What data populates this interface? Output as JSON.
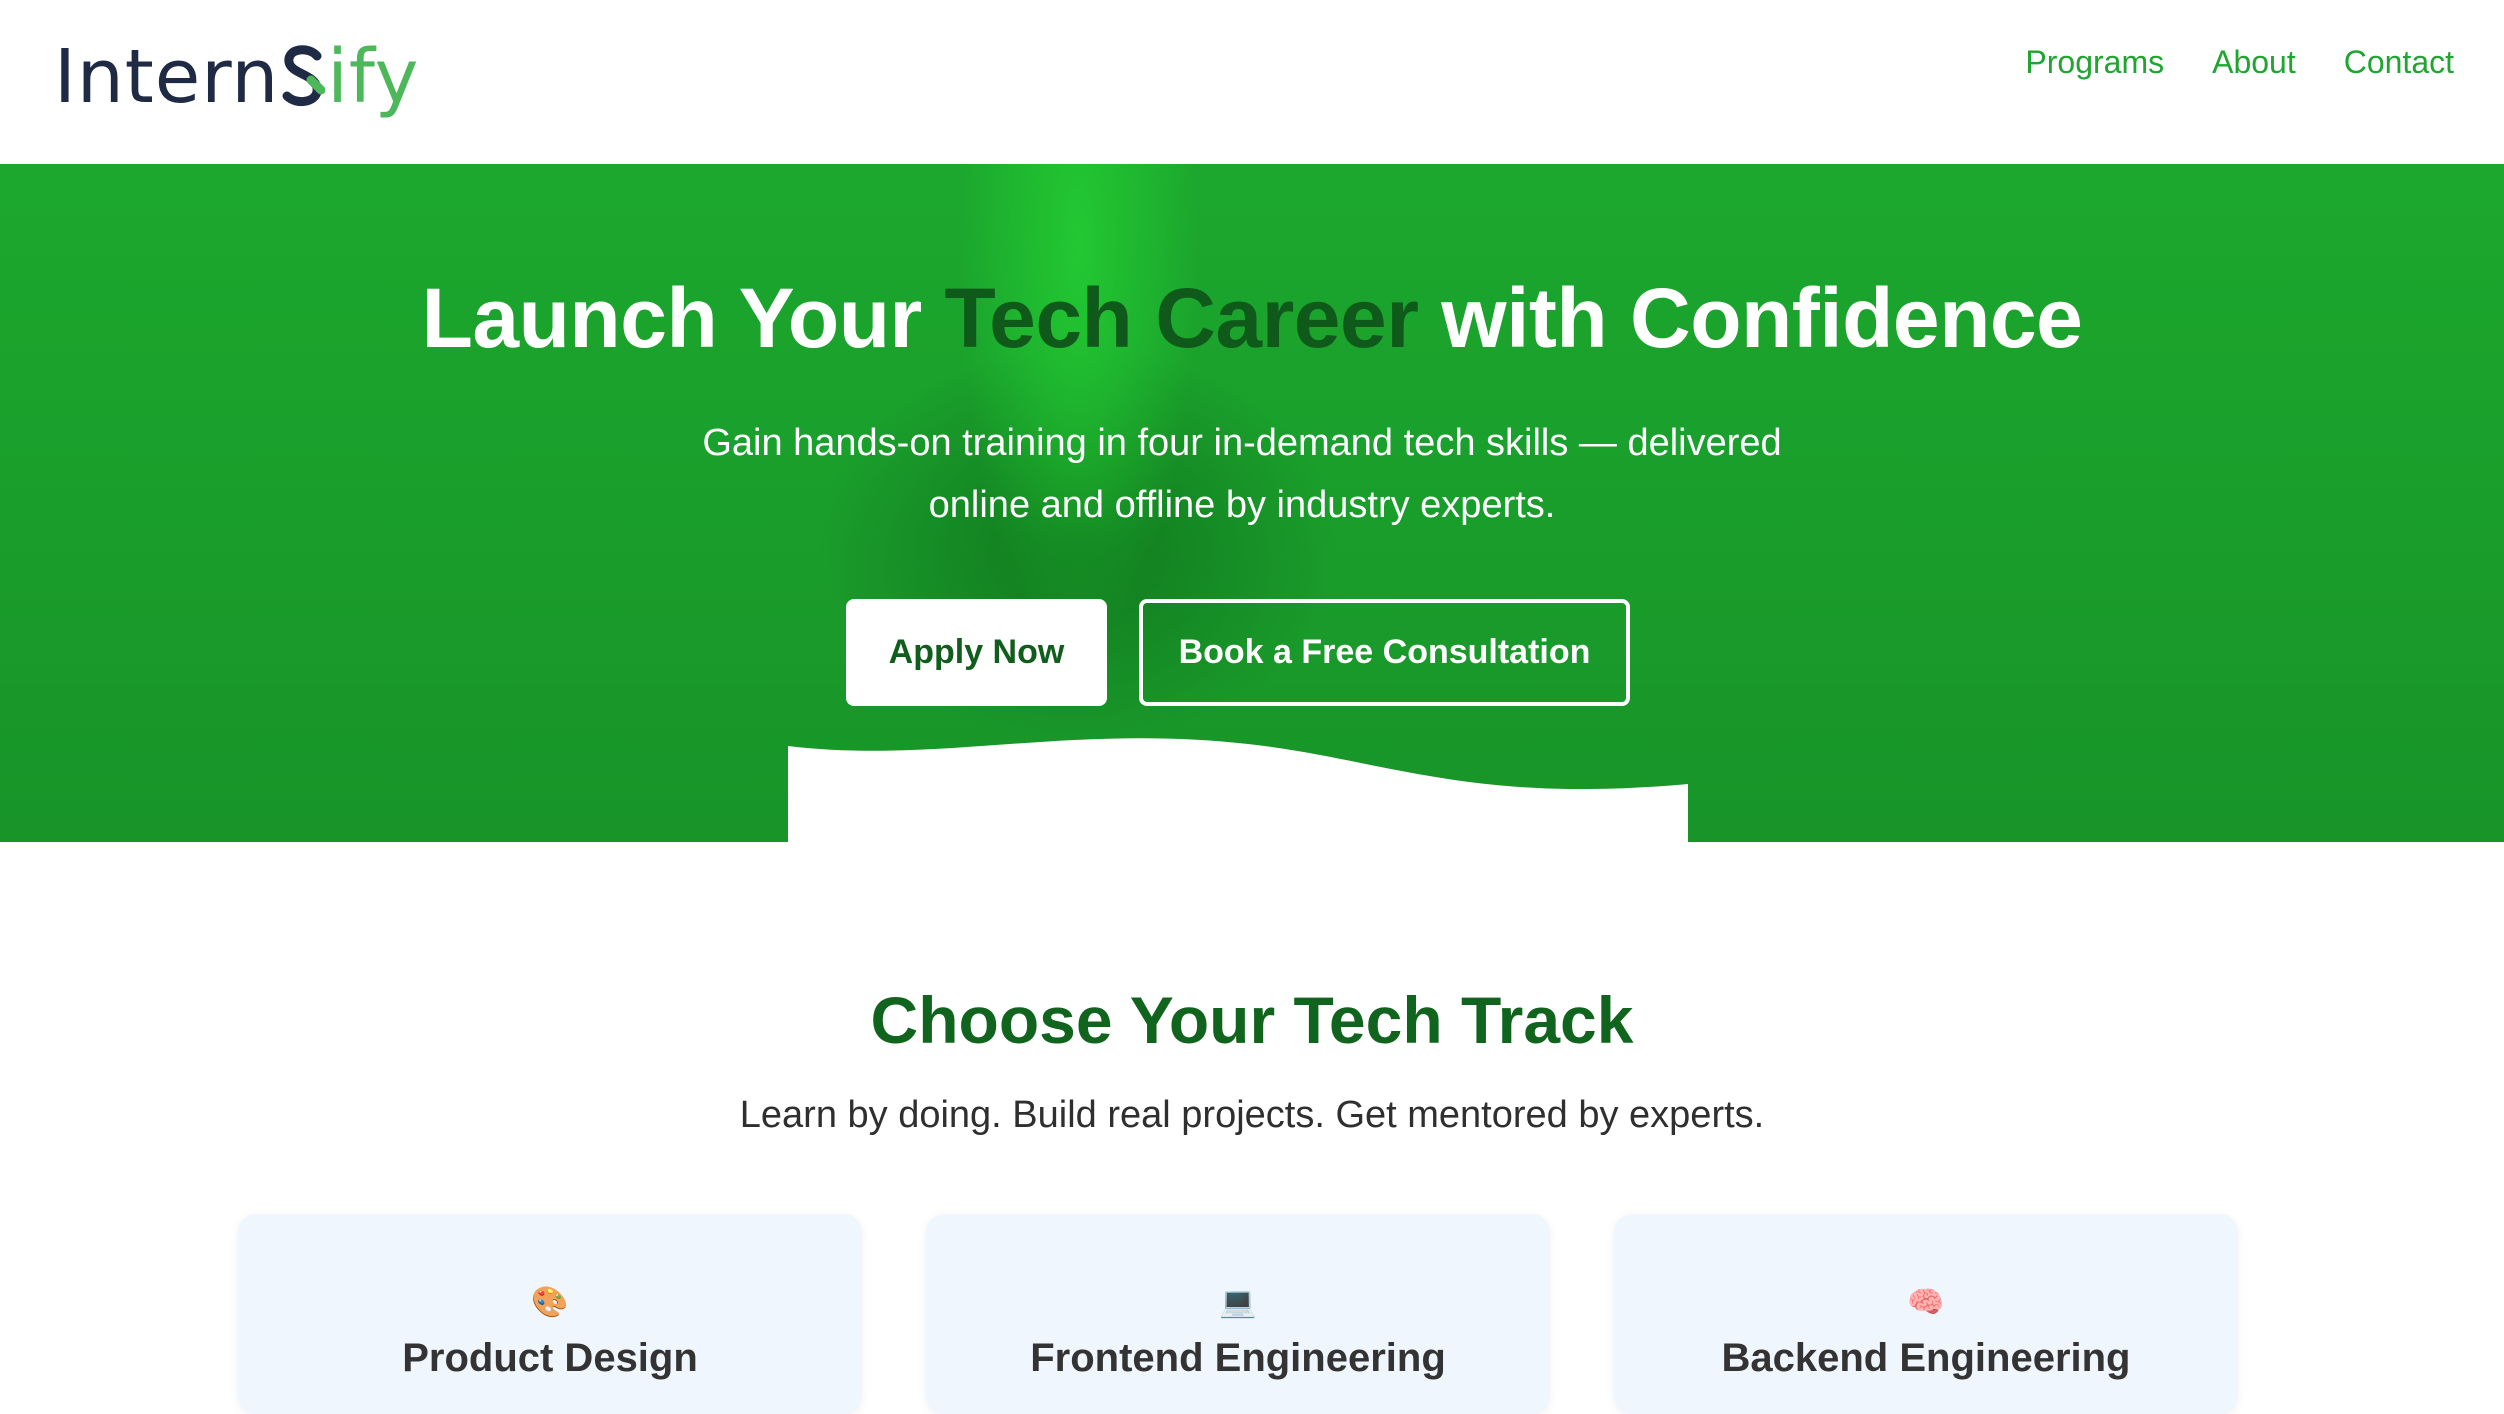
{
  "brand": {
    "logo_dark": "Intern",
    "logo_green": "ify",
    "colors": {
      "primary": "#1ca82e",
      "dark_green": "#0f5a1a",
      "logo_dark": "#1f2a44",
      "logo_green": "#4cb85a"
    }
  },
  "nav": {
    "items": [
      {
        "label": "Programs"
      },
      {
        "label": "About"
      },
      {
        "label": "Contact"
      }
    ]
  },
  "hero": {
    "title_before": "Launch Your ",
    "title_accent": "Tech Career",
    "title_after": " with Confidence",
    "subtitle": "Gain hands-on training in four in-demand tech skills — delivered online and offline by industry experts.",
    "apply_label": "Apply Now",
    "book_label": "Book a Free Consultation"
  },
  "tracks": {
    "title": "Choose Your Tech Track",
    "subtitle": "Learn by doing. Build real projects. Get mentored by experts.",
    "cards": [
      {
        "icon": "palette-icon",
        "icon_glyph": "🎨",
        "title": "Product Design"
      },
      {
        "icon": "laptop-icon",
        "icon_glyph": "💻",
        "title": "Frontend Engineering"
      },
      {
        "icon": "brain-icon",
        "icon_glyph": "🧠",
        "title": "Backend Engineering"
      }
    ]
  }
}
